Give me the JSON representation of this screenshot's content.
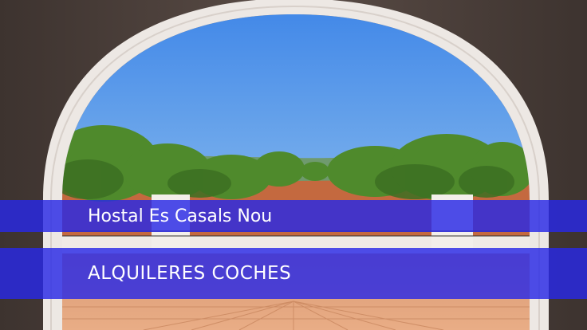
{
  "image": {
    "title": "Hostal Es Casals Nou",
    "subtitle": "ALQUILERES COCHES"
  },
  "colors": {
    "banner": "#2828e6",
    "sky_top": "#3f86e8",
    "sky_bottom": "#b8d8f2",
    "arch": "#ede8e4",
    "shadow_wall": "#4c403b",
    "tile": "#e2a27c",
    "foliage": "#4f8a2c"
  }
}
